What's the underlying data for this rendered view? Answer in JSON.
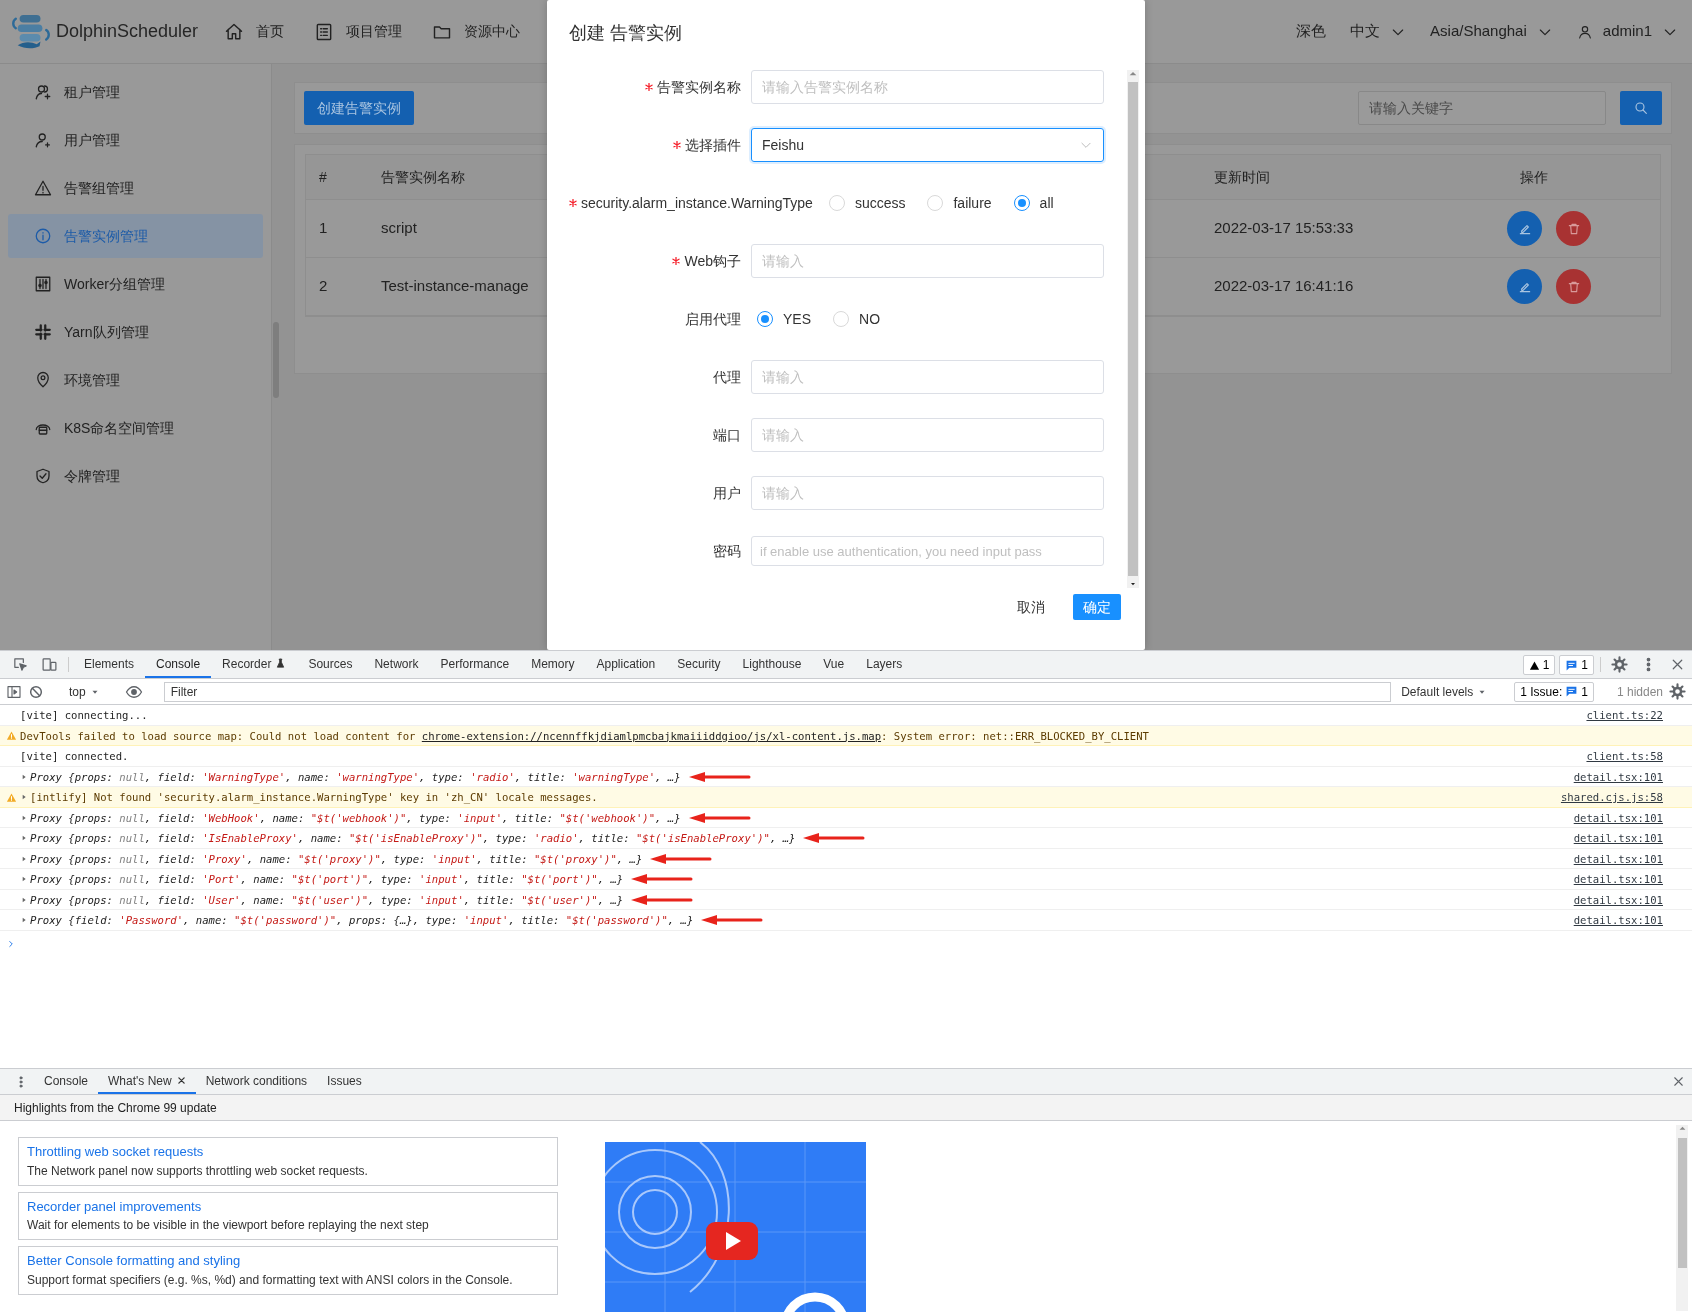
{
  "app": {
    "brand": "DolphinScheduler",
    "nav": [
      {
        "label": "首页"
      },
      {
        "label": "项目管理"
      },
      {
        "label": "资源中心"
      }
    ],
    "header_right": {
      "theme": "深色",
      "language": "中文",
      "timezone": "Asia/Shanghai",
      "user": "admin1"
    },
    "sidebar": {
      "items": [
        {
          "label": "租户管理",
          "selected": false
        },
        {
          "label": "用户管理",
          "selected": false
        },
        {
          "label": "告警组管理",
          "selected": false
        },
        {
          "label": "告警实例管理",
          "selected": true
        },
        {
          "label": "Worker分组管理",
          "selected": false
        },
        {
          "label": "Yarn队列管理",
          "selected": false
        },
        {
          "label": "环境管理",
          "selected": false
        },
        {
          "label": "K8S命名空间管理",
          "selected": false
        },
        {
          "label": "令牌管理",
          "selected": false
        }
      ]
    },
    "create_button": "创建告警实例",
    "search": {
      "placeholder": "请输入关键字"
    },
    "table": {
      "columns": [
        "#",
        "告警实例名称",
        "更新时间",
        "操作"
      ],
      "rows": [
        {
          "index": "1",
          "name": "script",
          "updated": "2022-03-17 15:53:33"
        },
        {
          "index": "2",
          "name": "Test-instance-manage",
          "updated": "2022-03-17 16:41:16"
        }
      ]
    }
  },
  "dialog": {
    "title": "创建 告警实例",
    "fields": [
      {
        "kind": "input",
        "label": "告警实例名称",
        "required": true,
        "placeholder": "请输入告警实例名称"
      },
      {
        "kind": "select",
        "label": "选择插件",
        "required": true,
        "value": "Feishu",
        "focused": true
      },
      {
        "kind": "radio",
        "label": "security.alarm_instance.WarningType",
        "required": true,
        "options": [
          {
            "label": "success",
            "selected": false
          },
          {
            "label": "failure",
            "selected": false
          },
          {
            "label": "all",
            "selected": true
          }
        ]
      },
      {
        "kind": "input",
        "label": "Web钩子",
        "required": true,
        "placeholder": "请输入"
      },
      {
        "kind": "radio",
        "label": "启用代理",
        "required": false,
        "options": [
          {
            "label": "YES",
            "selected": true
          },
          {
            "label": "NO",
            "selected": false
          }
        ]
      },
      {
        "kind": "input",
        "label": "代理",
        "required": false,
        "placeholder": "请输入"
      },
      {
        "kind": "input",
        "label": "端口",
        "required": false,
        "placeholder": "请输入"
      },
      {
        "kind": "input",
        "label": "用户",
        "required": false,
        "placeholder": "请输入"
      },
      {
        "kind": "input",
        "label": "密码",
        "required": false,
        "placeholder": "if enable use authentication, you need input pass"
      }
    ],
    "cancel": "取消",
    "confirm": "确定"
  },
  "devtools": {
    "tabs": [
      {
        "label": "Elements",
        "selected": false
      },
      {
        "label": "Console",
        "selected": true
      },
      {
        "label": "Recorder",
        "selected": false
      },
      {
        "label": "Sources",
        "selected": false
      },
      {
        "label": "Network",
        "selected": false
      },
      {
        "label": "Performance",
        "selected": false
      },
      {
        "label": "Memory",
        "selected": false
      },
      {
        "label": "Application",
        "selected": false
      },
      {
        "label": "Security",
        "selected": false
      },
      {
        "label": "Lighthouse",
        "selected": false
      },
      {
        "label": "Vue",
        "selected": false
      },
      {
        "label": "Layers",
        "selected": false
      }
    ],
    "warning_count": "1",
    "message_count": "1",
    "context": "top",
    "filter_placeholder": "Filter",
    "levels": "Default levels",
    "issues_label": "1 Issue:",
    "issues_count": "1",
    "hidden": "1 hidden",
    "messages": [
      {
        "kind": "log",
        "text": "[vite] connecting...",
        "source": "client.ts:22"
      },
      {
        "kind": "warning",
        "text": "DevTools failed to load source map: Could not load content for ",
        "link": "chrome-extension://ncennffkjdiamlpmcbajkmaiiiddgioo/js/xl-content.js.map",
        "after": ": System error: net::ERR_BLOCKED_BY_CLIENT"
      },
      {
        "kind": "log",
        "text": "[vite] connected.",
        "source": "client.ts:58"
      },
      {
        "kind": "object",
        "text": "Proxy {props: null, field: 'WarningType', name: 'warningType', type: 'radio', title: 'warningType', …}",
        "source": "detail.tsx:101",
        "annotated": true
      },
      {
        "kind": "warning",
        "expandable": true,
        "text": "[intlify] Not found 'security.alarm_instance.WarningType' key in 'zh_CN' locale messages.",
        "source": "shared.cjs.js:58"
      },
      {
        "kind": "object",
        "text": "Proxy {props: null, field: 'WebHook', name: \"$t('webhook')\", type: 'input', title: \"$t('webhook')\", …}",
        "source": "detail.tsx:101",
        "annotated": true
      },
      {
        "kind": "object",
        "text": "Proxy {props: null, field: 'IsEnableProxy', name: \"$t('isEnableProxy')\", type: 'radio', title: \"$t('isEnableProxy')\", …}",
        "source": "detail.tsx:101",
        "annotated": true
      },
      {
        "kind": "object",
        "text": "Proxy {props: null, field: 'Proxy', name: \"$t('proxy')\", type: 'input', title: \"$t('proxy')\", …}",
        "source": "detail.tsx:101",
        "annotated": true
      },
      {
        "kind": "object",
        "text": "Proxy {props: null, field: 'Port', name: \"$t('port')\", type: 'input', title: \"$t('port')\", …}",
        "source": "detail.tsx:101",
        "annotated": true
      },
      {
        "kind": "object",
        "text": "Proxy {props: null, field: 'User', name: \"$t('user')\", type: 'input', title: \"$t('user')\", …}",
        "source": "detail.tsx:101",
        "annotated": true
      },
      {
        "kind": "object",
        "text": "Proxy {field: 'Password', name: \"$t('password')\", props: {…}, type: 'input', title: \"$t('password')\", …}",
        "source": "detail.tsx:101",
        "annotated": true
      }
    ]
  },
  "drawer": {
    "tabs": [
      {
        "label": "Console",
        "selected": false,
        "closable": false
      },
      {
        "label": "What's New",
        "selected": true,
        "closable": true
      },
      {
        "label": "Network conditions",
        "selected": false,
        "closable": false
      },
      {
        "label": "Issues",
        "selected": false,
        "closable": false
      }
    ],
    "heading": "Highlights from the Chrome 99 update",
    "cards": [
      {
        "title": "Throttling web socket requests",
        "description": "The Network panel now supports throttling web socket requests."
      },
      {
        "title": "Recorder panel improvements",
        "description": "Wait for elements to be visible in the viewport before replaying the next step"
      },
      {
        "title": "Better Console formatting and styling",
        "description": "Support format specifiers (e.g. %s, %d) and formatting text with ANSI colors in the Console."
      }
    ]
  }
}
